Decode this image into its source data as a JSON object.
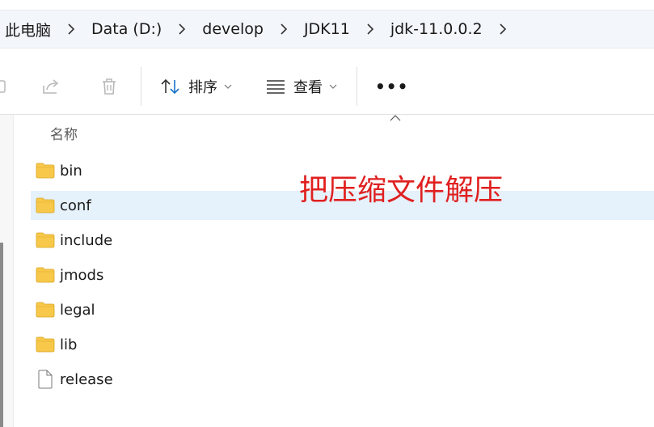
{
  "breadcrumb": {
    "items": [
      {
        "label": "此电脑"
      },
      {
        "label": "Data (D:)"
      },
      {
        "label": "develop"
      },
      {
        "label": "JDK11"
      },
      {
        "label": "jdk-11.0.0.2"
      }
    ]
  },
  "toolbar": {
    "sort_label": "排序",
    "view_label": "查看",
    "more_label": "•••"
  },
  "file_list": {
    "header_name": "名称",
    "items": [
      {
        "name": "bin",
        "type": "folder",
        "selected": false
      },
      {
        "name": "conf",
        "type": "folder",
        "selected": true
      },
      {
        "name": "include",
        "type": "folder",
        "selected": false
      },
      {
        "name": "jmods",
        "type": "folder",
        "selected": false
      },
      {
        "name": "legal",
        "type": "folder",
        "selected": false
      },
      {
        "name": "lib",
        "type": "folder",
        "selected": false
      },
      {
        "name": "release",
        "type": "file",
        "selected": false
      }
    ]
  },
  "annotation": {
    "text": "把压缩文件解压",
    "color": "#e02020"
  },
  "colors": {
    "selection": "#e5f1fb",
    "folder": "#f7c84a",
    "address_bar": "#f3f6fb"
  }
}
